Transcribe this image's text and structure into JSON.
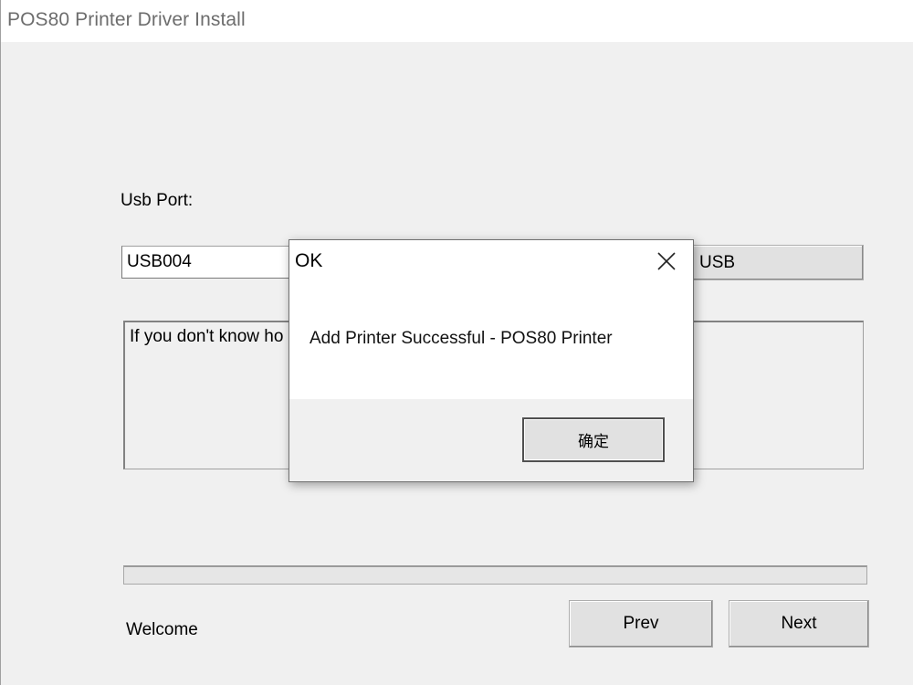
{
  "window": {
    "title": "POS80 Printer Driver Install"
  },
  "main": {
    "usb_port_label": "Usb Port:",
    "usb_port_value": "USB004",
    "usb_button_label": "USB",
    "info_text": "If you don't know ho",
    "progress_fraction": 0,
    "status_text": "Welcome",
    "prev_label": "Prev",
    "next_label": "Next"
  },
  "dialog": {
    "title": "OK",
    "message": "Add Printer Successful - POS80 Printer",
    "ok_label": "确定",
    "close_icon": "close-icon"
  }
}
